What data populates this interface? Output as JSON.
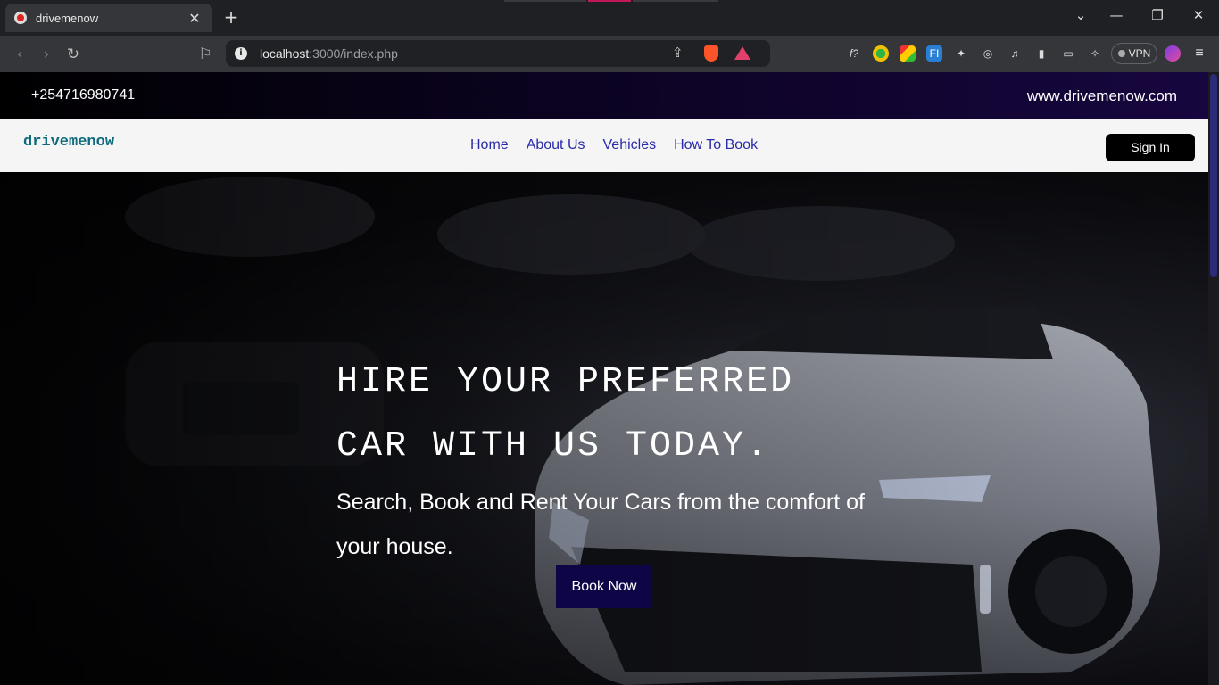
{
  "browser": {
    "tab_title": "drivemenow",
    "tab_close": "✕",
    "new_tab": "+",
    "url_host": "localhost",
    "url_path": ":3000/index.php",
    "vpn_label": "VPN",
    "ext_fx_label": "f?",
    "ext_fi_label": "FI"
  },
  "topbar": {
    "phone": "+254716980741",
    "website": "www.drivemenow.com"
  },
  "navbar": {
    "brand": "drivemenow",
    "links": [
      "Home",
      "About Us",
      "Vehicles",
      "How To Book"
    ],
    "signin_label": "Sign In"
  },
  "hero": {
    "title_line1": "HIRE YOUR PREFERRED",
    "title_line2": "CAR WITH US TODAY.",
    "subtitle": "Search, Book and Rent Your Cars from the comfort of your house.",
    "cta_label": "Book Now"
  },
  "colors": {
    "nav_link": "#2a2aa8",
    "brand": "#0e6b7d",
    "cta_bg": "#0e0547",
    "topbar_end": "#17063f"
  }
}
